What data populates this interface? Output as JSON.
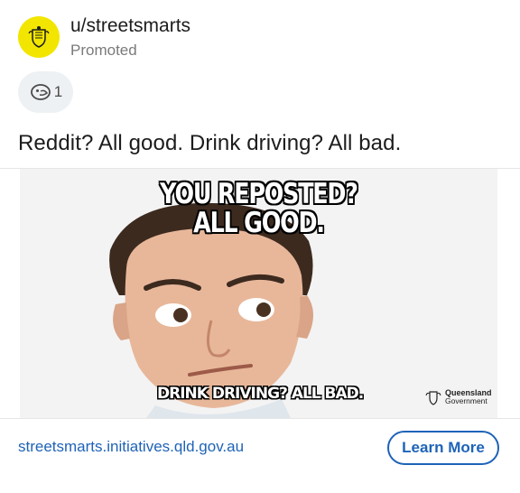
{
  "post": {
    "username": "u/streetsmarts",
    "promoted_label": "Promoted",
    "award_count": "1",
    "title": "Reddit? All good. Drink driving? All bad."
  },
  "meme": {
    "top_line_1": "YOU REPOSTED?",
    "top_line_2": "ALL GOOD.",
    "bottom_text": "DRINK DRIVING? ALL BAD.",
    "logo_line_1": "Queensland",
    "logo_line_2": "Government"
  },
  "footer": {
    "link_text": "streetsmarts.initiatives.qld.gov.au",
    "cta_label": "Learn More"
  },
  "colors": {
    "accent": "#1e63b8",
    "avatar_bg": "#f2e600",
    "muted_text": "#7a7a7a"
  },
  "icons": {
    "avatar": "queensland-crest-icon",
    "award": "award-icon"
  }
}
